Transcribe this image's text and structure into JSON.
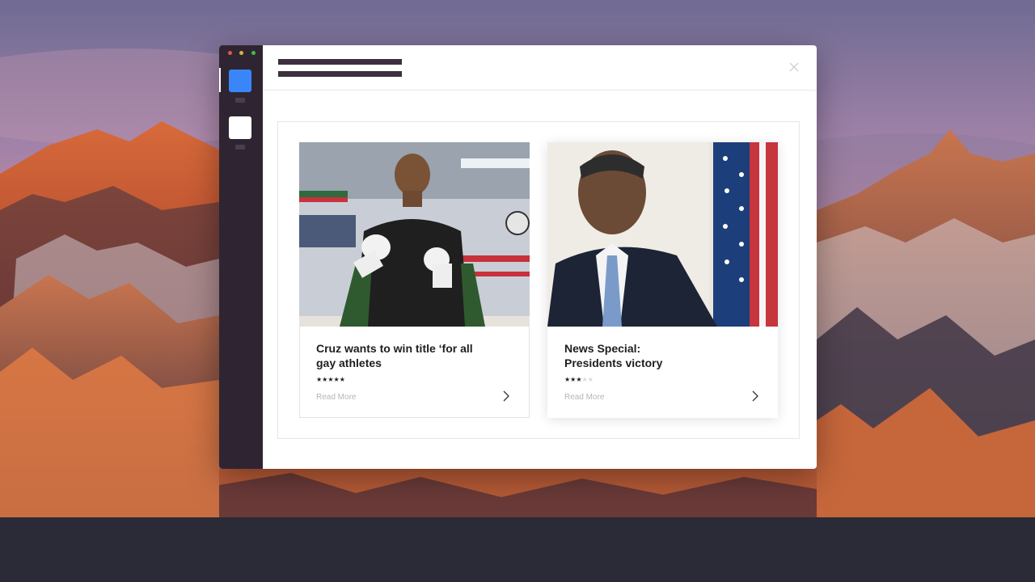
{
  "window": {
    "close_icon": "close-icon",
    "menu_icon": "hamburger-menu-icon"
  },
  "sidebar": {
    "apps": [
      {
        "name": "app-blue",
        "color": "#3a86f8",
        "active": true
      },
      {
        "name": "app-white",
        "color": "#ffffff",
        "active": false
      }
    ]
  },
  "cards": [
    {
      "title_line1": "Cruz wants to win title ‘for all",
      "title_line2": "gay athletes",
      "rating": 5,
      "rating_max": 5,
      "read_more": "Read More",
      "image": "boxer-training-photo"
    },
    {
      "title_line1": "News Special:",
      "title_line2": "Presidents victory",
      "rating": 3,
      "rating_max": 5,
      "read_more": "Read More",
      "image": "president-portrait-photo"
    }
  ],
  "colors": {
    "sidebar_bg": "#2f2532",
    "accent_blue": "#3a86f8",
    "desktop_bottom": "#2a2b37"
  }
}
